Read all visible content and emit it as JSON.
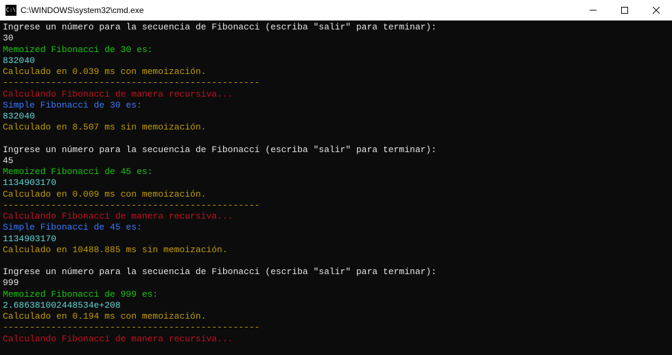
{
  "window": {
    "title": "C:\\WINDOWS\\system32\\cmd.exe",
    "icon_label": "cmd-icon"
  },
  "lines": [
    {
      "cls": "c-white",
      "text": "Ingrese un número para la secuencia de Fibonacci (escriba \"salir\" para terminar):"
    },
    {
      "cls": "c-white",
      "text": "30"
    },
    {
      "cls": "c-green",
      "text": "Memoized Fibonacci de 30 es:"
    },
    {
      "cls": "c-cyan",
      "text": "832040"
    },
    {
      "cls": "c-yellow",
      "text": "Calculado en 0.039 ms con memoización."
    },
    {
      "cls": "c-yellow",
      "text": "------------------------------------------------"
    },
    {
      "cls": "c-red",
      "text": "Calculando Fibonacci de manera recursiva..."
    },
    {
      "cls": "c-blue",
      "text": "Simple Fibonacci de 30 es:"
    },
    {
      "cls": "c-cyan",
      "text": "832040"
    },
    {
      "cls": "c-yellow",
      "text": "Calculado en 8.507 ms sin memoización."
    },
    {
      "cls": "c-white",
      "text": ""
    },
    {
      "cls": "c-white",
      "text": "Ingrese un número para la secuencia de Fibonacci (escriba \"salir\" para terminar):"
    },
    {
      "cls": "c-white",
      "text": "45"
    },
    {
      "cls": "c-green",
      "text": "Memoized Fibonacci de 45 es:"
    },
    {
      "cls": "c-cyan",
      "text": "1134903170"
    },
    {
      "cls": "c-yellow",
      "text": "Calculado en 0.009 ms con memoización."
    },
    {
      "cls": "c-yellow",
      "text": "------------------------------------------------"
    },
    {
      "cls": "c-red",
      "text": "Calculando Fibonacci de manera recursiva..."
    },
    {
      "cls": "c-blue",
      "text": "Simple Fibonacci de 45 es:"
    },
    {
      "cls": "c-cyan",
      "text": "1134903170"
    },
    {
      "cls": "c-yellow",
      "text": "Calculado en 10488.885 ms sin memoización."
    },
    {
      "cls": "c-white",
      "text": ""
    },
    {
      "cls": "c-white",
      "text": "Ingrese un número para la secuencia de Fibonacci (escriba \"salir\" para terminar):"
    },
    {
      "cls": "c-white",
      "text": "999"
    },
    {
      "cls": "c-green",
      "text": "Memoized Fibonacci de 999 es:"
    },
    {
      "cls": "c-cyan",
      "text": "2.686381002448534e+208"
    },
    {
      "cls": "c-yellow",
      "text": "Calculado en 0.194 ms con memoización."
    },
    {
      "cls": "c-yellow",
      "text": "------------------------------------------------"
    },
    {
      "cls": "c-red",
      "text": "Calculando Fibonacci de manera recursiva..."
    }
  ]
}
